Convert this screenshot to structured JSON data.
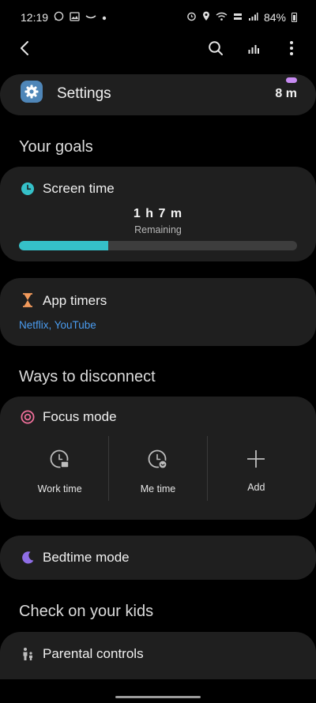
{
  "status_bar": {
    "time": "12:19",
    "battery": "84%"
  },
  "app_usage": {
    "name": "Settings",
    "time": "8 m"
  },
  "goals": {
    "title": "Your goals",
    "screen_time": {
      "label": "Screen time",
      "value": "1 h 7 m",
      "sub": "Remaining",
      "progress_percent": 32
    },
    "app_timers": {
      "label": "App timers",
      "apps": "Netflix, YouTube"
    }
  },
  "disconnect": {
    "title": "Ways to disconnect",
    "focus_mode": {
      "label": "Focus mode",
      "items": [
        {
          "label": "Work time",
          "icon": "work-time-icon"
        },
        {
          "label": "Me time",
          "icon": "me-time-icon"
        },
        {
          "label": "Add",
          "icon": "plus-icon"
        }
      ]
    },
    "bedtime_mode": {
      "label": "Bedtime mode"
    }
  },
  "kids": {
    "title": "Check on your kids",
    "parental_controls": {
      "label": "Parental controls"
    }
  },
  "colors": {
    "background": "#000000",
    "card": "#1f1f1f",
    "accent_teal": "#35c0c8",
    "link_blue": "#4a9cf0",
    "focus_pink": "#ef6f9a",
    "bedtime_purple": "#8f6ee6",
    "timer_orange": "#f29a5c",
    "app_icon_blue": "#4f86b8"
  }
}
